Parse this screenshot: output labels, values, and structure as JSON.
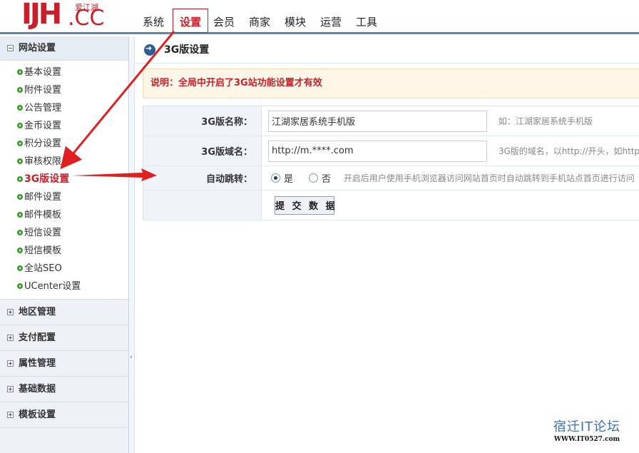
{
  "header": {
    "logo_main": "IJH",
    "logo_cn": "爱江湖",
    "logo_cc": ".CC",
    "nav": [
      {
        "label": "系统"
      },
      {
        "label": "设置"
      },
      {
        "label": "会员"
      },
      {
        "label": "商家"
      },
      {
        "label": "模块"
      },
      {
        "label": "运营"
      },
      {
        "label": "工具"
      }
    ],
    "active_nav": "设置"
  },
  "sidebar": {
    "groups": [
      {
        "label": "网站设置",
        "expanded": true
      },
      {
        "label": "地区管理",
        "expanded": false
      },
      {
        "label": "支付配置",
        "expanded": false
      },
      {
        "label": "属性管理",
        "expanded": false
      },
      {
        "label": "基础数据",
        "expanded": false
      },
      {
        "label": "模板设置",
        "expanded": false
      }
    ],
    "items": [
      {
        "label": "基本设置"
      },
      {
        "label": "附件设置"
      },
      {
        "label": "公告管理"
      },
      {
        "label": "金币设置"
      },
      {
        "label": "积分设置"
      },
      {
        "label": "审核权限"
      },
      {
        "label": "3G版设置"
      },
      {
        "label": "邮件设置"
      },
      {
        "label": "邮件模板"
      },
      {
        "label": "短信设置"
      },
      {
        "label": "短信模板"
      },
      {
        "label": "全站SEO"
      },
      {
        "label": "UCenter设置"
      }
    ],
    "active_item": "3G版设置",
    "collapse_glyph": "‹"
  },
  "main": {
    "title": "3G版设置",
    "notice": "说明：全局中开启了3G站功能设置才有效",
    "form": {
      "name_label": "3G版名称：",
      "name_value": "江湖家居系统手机版",
      "name_hint": "如：江湖家居系统手机版",
      "domain_label": "3G版域名：",
      "domain_value": "http://m.****.com",
      "domain_hint": "3G版的域名，以http://开头，如http",
      "redirect_label": "自动跳转：",
      "redirect_yes": "是",
      "redirect_no": "否",
      "redirect_selected": "是",
      "redirect_hint": "开启后用户使用手机浏览器访问网站首页时自动跳转到手机站点首页进行访问",
      "submit_label": "提 交 数 据"
    }
  },
  "watermark": {
    "cn": "宿迁IT论坛",
    "url": "WWW.IT0527.com"
  },
  "colors": {
    "brand": "#c8202a",
    "nav_border": "#5f86b3",
    "annotation_arrow": "#e02020",
    "notice_bg": "#fff6e8"
  }
}
